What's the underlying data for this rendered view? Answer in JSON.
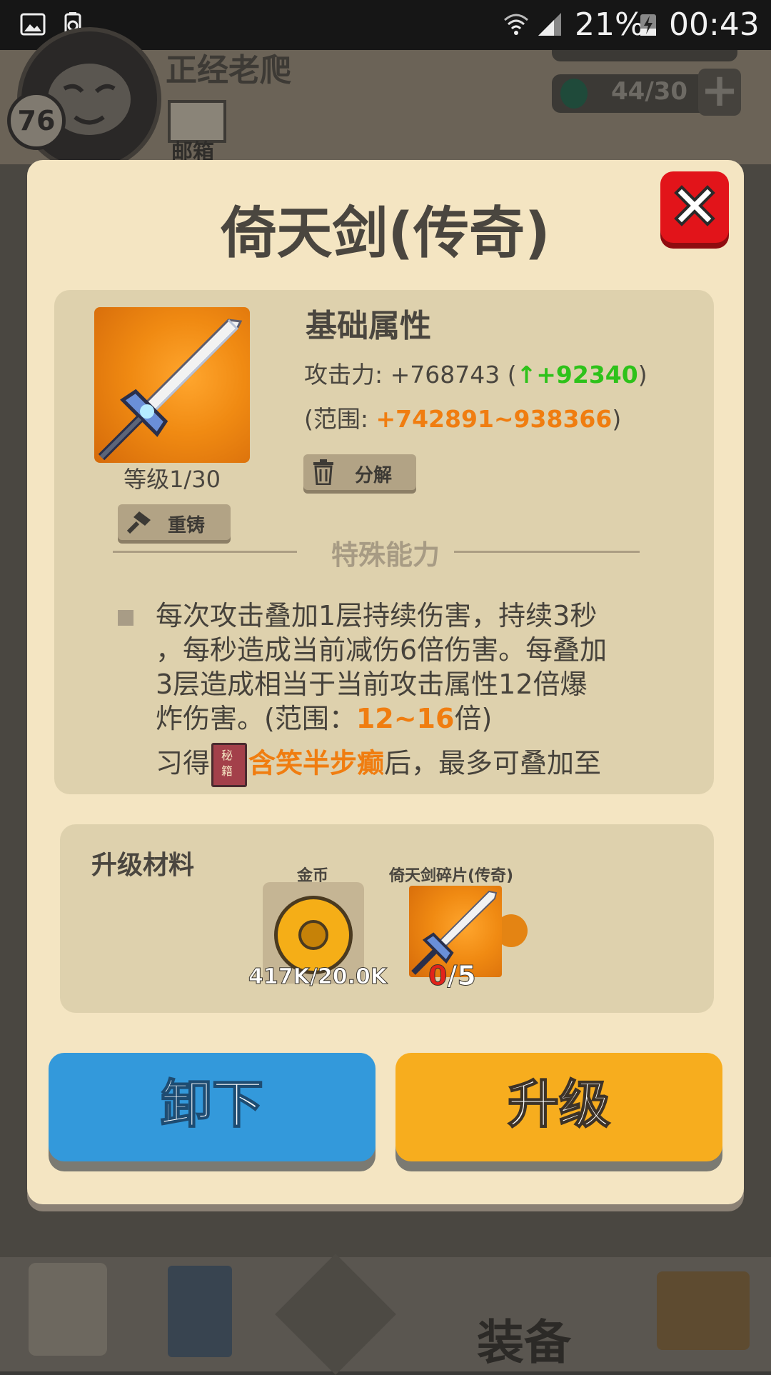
{
  "status_bar": {
    "battery_percent": "21%",
    "time": "00:43",
    "icons": [
      "gallery-icon",
      "recycle-battery-icon",
      "wifi-icon",
      "signal-icon",
      "battery-charging-icon"
    ]
  },
  "background": {
    "player_level": "76",
    "player_name": "正经老爬",
    "mail_label": "邮箱",
    "gem_count": "44/30",
    "nav_active_label": "装备"
  },
  "dialog": {
    "title": "倚天剑(传奇)",
    "item": {
      "icon": "legendary-sword-icon",
      "level": "等级1/30",
      "reforge_label": "重铸"
    },
    "base_stats": {
      "heading": "基础属性",
      "attack_label": "攻击力: +768743 (",
      "attack_arrow": "↑",
      "attack_gain": "+92340",
      "attack_close": ")",
      "range_label": "(范围: ",
      "range_value": "+742891~938366",
      "range_close": ")",
      "decompose_label": "分解"
    },
    "special": {
      "heading": "特殊能力",
      "lines": [
        "每次攻击叠加1层持续伤害，持续3秒",
        "，每秒造成当前减伤6倍伤害。每叠加",
        "3层造成相当于当前攻击属性12倍爆",
        "炸伤害。(范围："
      ],
      "range_value": "12~16",
      "range_suffix": "倍)",
      "learn_prefix": "习得",
      "book_icon_text": "秘籍",
      "skill_name": "含笑半步癫",
      "learn_suffix": "后，最多可叠加至"
    },
    "materials": {
      "heading": "升级材料",
      "gold": {
        "label": "金币",
        "count": "417K/20.0K"
      },
      "shard": {
        "label": "倚天剑碎片(传奇)",
        "have": "0",
        "need": "/5"
      }
    },
    "buttons": {
      "unequip": "卸下",
      "upgrade": "升级"
    }
  },
  "colors": {
    "dialog_bg": "#f4e5c2",
    "panel_bg": "#ded1ad",
    "unequip_blue": "#3399db",
    "upgrade_orange": "#f7ad1e",
    "close_red": "#e2141a",
    "stat_green": "#2ec21a",
    "stat_orange": "#f07d10"
  }
}
